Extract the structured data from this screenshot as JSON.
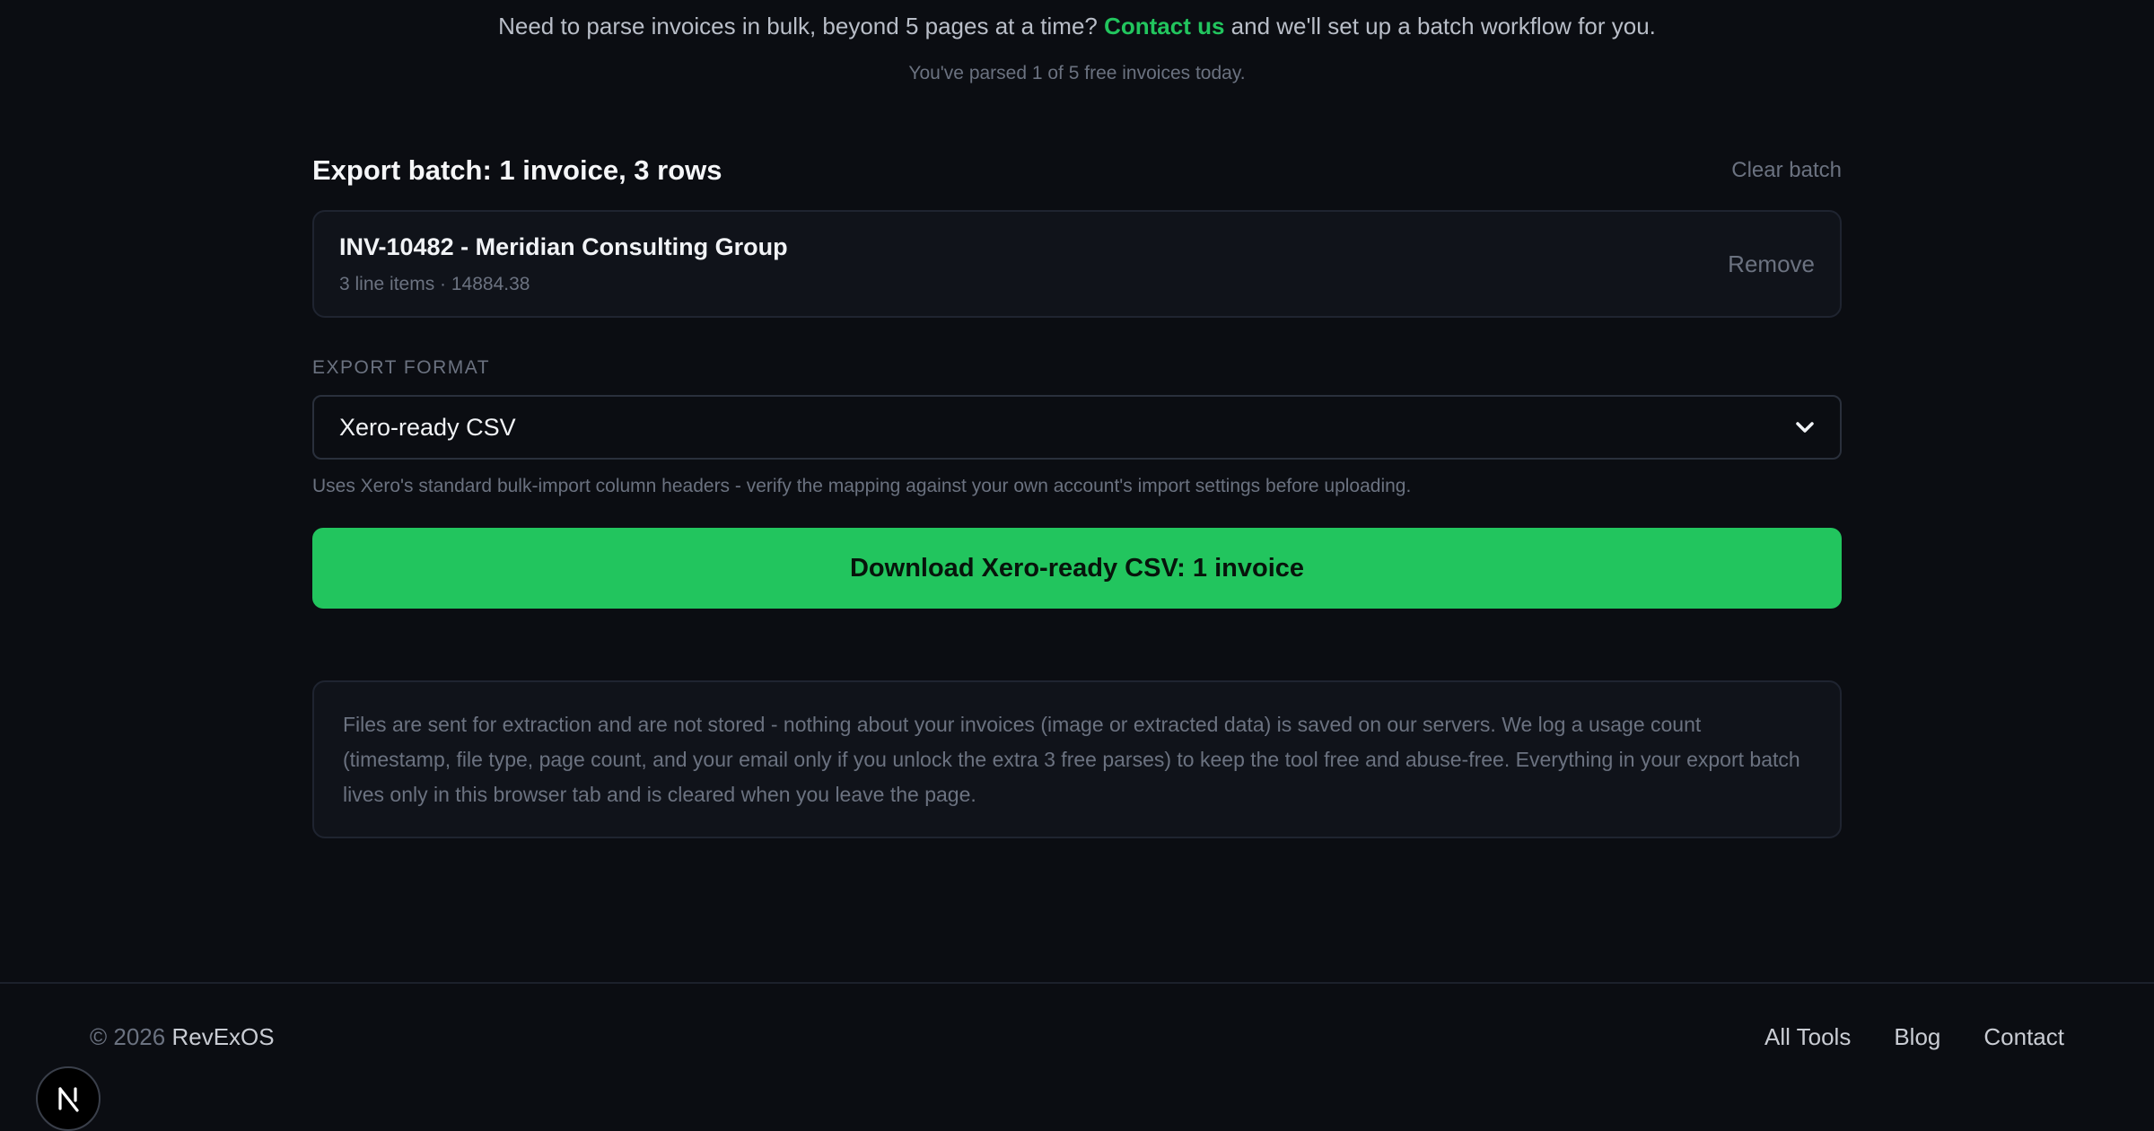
{
  "notice": {
    "prefix": "Need to parse invoices in bulk, beyond 5 pages at a time?",
    "link": "Contact us",
    "suffix": "and we'll set up a batch workflow for you."
  },
  "usage": "You've parsed 1 of 5 free invoices today.",
  "batch": {
    "title": "Export batch: 1 invoice, 3 rows",
    "clear_label": "Clear batch",
    "invoices": [
      {
        "title": "INV-10482 - Meridian Consulting Group",
        "meta": "3 line items · 14884.38",
        "remove_label": "Remove"
      }
    ]
  },
  "export": {
    "label": "EXPORT FORMAT",
    "selected": "Xero-ready CSV",
    "help": "Uses Xero's standard bulk-import column headers - verify the mapping against your own account's import settings before uploading.",
    "download_label": "Download Xero-ready CSV: 1 invoice"
  },
  "privacy": "Files are sent for extraction and are not stored - nothing about your invoices (image or extracted data) is saved on our servers. We log a usage count (timestamp, file type, page count, and your email only if you unlock the extra 3 free parses) to keep the tool free and abuse-free. Everything in your export batch lives only in this browser tab and is cleared when you leave the page.",
  "footer": {
    "copyright_prefix": "© 2026",
    "brand": "RevExOS",
    "links": [
      "All Tools",
      "Blog",
      "Contact"
    ]
  },
  "badge_letter": "N",
  "colors": {
    "background": "#0b0d12",
    "accent": "#22c55e",
    "muted": "#6b7280"
  },
  "icons": {
    "select_chevron": "chevron-down-icon",
    "badge": "nextjs-logo-icon"
  }
}
